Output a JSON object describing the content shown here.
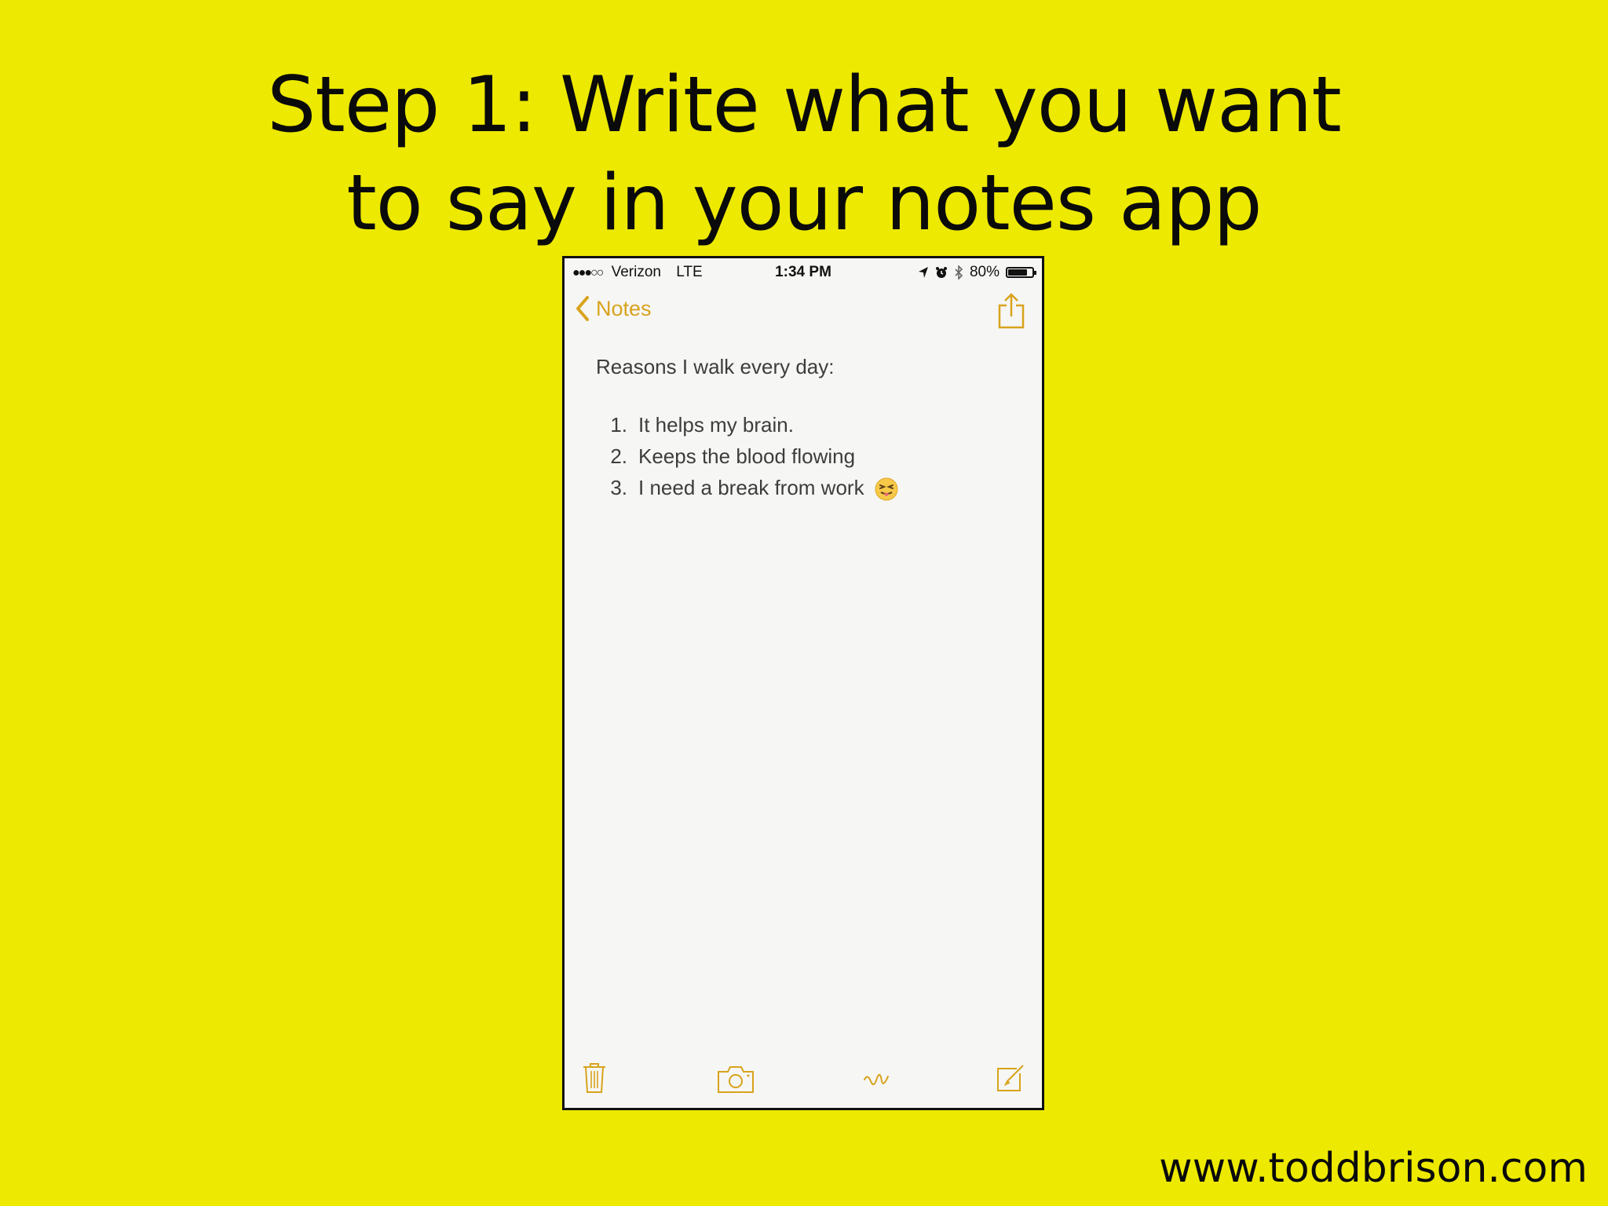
{
  "slide": {
    "title_line1": "Step 1: Write what you want",
    "title_line2": "to say in your notes app",
    "footer_url": "www.toddbrison.com",
    "background_color": "#ede900"
  },
  "status_bar": {
    "signal": "●●●○○",
    "carrier": "Verizon",
    "network": "LTE",
    "time": "1:34 PM",
    "battery_percent": "80%",
    "battery_level": 0.8,
    "icons": [
      "location-icon",
      "alarm-icon",
      "bluetooth-icon",
      "battery-icon"
    ]
  },
  "nav": {
    "back_label": "Notes",
    "accent_color": "#d8a31d",
    "share_icon": "share-icon"
  },
  "note": {
    "heading": "Reasons I walk every day:",
    "items": [
      {
        "num": "1.",
        "text": "It helps my brain."
      },
      {
        "num": "2.",
        "text": "Keeps the blood flowing"
      },
      {
        "num": "3.",
        "text": "I need a break from work",
        "emoji": "tongue-out-emoji"
      }
    ]
  },
  "toolbar": {
    "icons": [
      "trash-icon",
      "camera-icon",
      "sketch-icon",
      "compose-icon"
    ]
  }
}
